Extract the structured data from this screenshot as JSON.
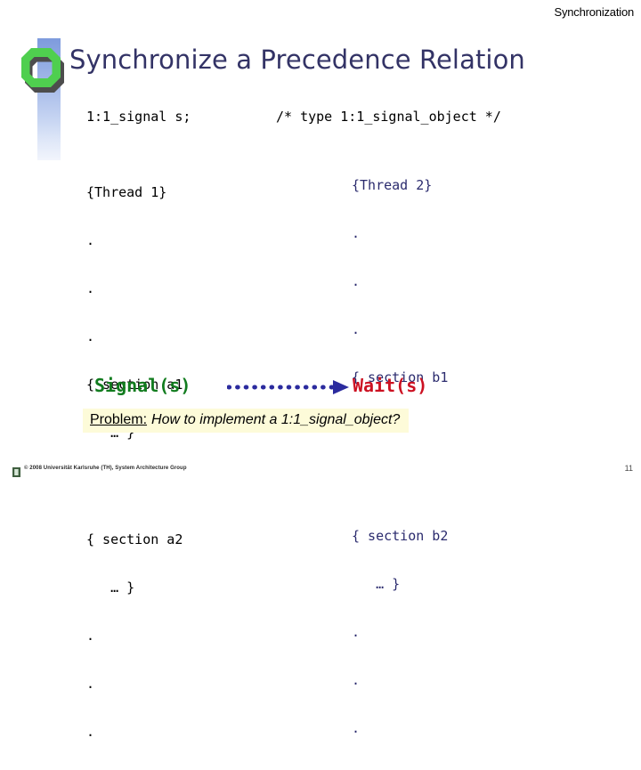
{
  "header": {
    "section_title": "Synchronization"
  },
  "title": {
    "text": "Synchronize a Precedence Relation",
    "color": "#333366"
  },
  "logo": {
    "ring_color": "#4fcf4f",
    "shadow_color": "#4d4d4d",
    "bar_top_color": "#7e9bdd",
    "bar_bottom_color": "#f2f5fc",
    "icon_name": "octagon-ring-logo"
  },
  "code": {
    "declaration": {
      "type_decl": "1:1_signal s;",
      "comment": "/* type 1:1_signal_object */"
    },
    "thread_left": {
      "color": "#000000",
      "lines": [
        "{Thread 1}",
        ".",
        ".",
        ".",
        "{ section a1",
        "   … }"
      ],
      "lines_after": [
        "{ section a2",
        "   … }",
        ".",
        ".",
        "."
      ],
      "call": "Signal(s)",
      "call_color": "#127c1f"
    },
    "thread_right": {
      "color": "#2b2b6e",
      "lines": [
        "{Thread 2}",
        ".",
        ".",
        ".",
        "{ section b1",
        "   … }"
      ],
      "lines_after": [
        "{ section b2",
        "   … }",
        ".",
        ".",
        "."
      ],
      "call": "Wait(s)",
      "call_color": "#cc1122"
    },
    "arrow": {
      "name": "precedence-arrow",
      "style": "dotted",
      "color": "#2b2b9e",
      "direction": "left-to-right"
    }
  },
  "problem": {
    "label": "Problem:",
    "question": "How to implement a 1:1_signal_object?",
    "background": "#fdfbd9"
  },
  "footer": {
    "copyright": "© 2008 Universität Karlsruhe (TH), System Architecture Group",
    "slide_number": "11"
  }
}
